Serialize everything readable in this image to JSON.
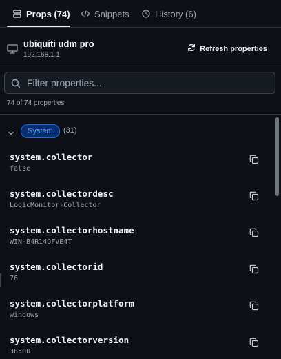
{
  "tabs": [
    {
      "label": "Props (74)",
      "icon": "server-stack-icon",
      "active": true
    },
    {
      "label": "Snippets",
      "icon": "code-icon",
      "active": false
    },
    {
      "label": "History (6)",
      "icon": "clock-icon",
      "active": false
    }
  ],
  "device": {
    "name": "ubiquiti udm pro",
    "ip": "192.168.1.1",
    "icon": "monitor-icon"
  },
  "refresh": {
    "label": "Refresh properties",
    "icon": "refresh-icon"
  },
  "filter": {
    "placeholder": "Filter properties...",
    "value": "",
    "icon": "search-icon"
  },
  "count_text": "74 of 74 properties",
  "group": {
    "badge": "System",
    "count": "(31)",
    "expanded": true
  },
  "properties": [
    {
      "key": "system.collector",
      "value": "false"
    },
    {
      "key": "system.collectordesc",
      "value": "LogicMonitor-Collector"
    },
    {
      "key": "system.collectorhostname",
      "value": "WIN-B4R14QFVE4T"
    },
    {
      "key": "system.collectorid",
      "value": "76"
    },
    {
      "key": "system.collectorplatform",
      "value": "windows"
    },
    {
      "key": "system.collectorversion",
      "value": "38500"
    }
  ],
  "colors": {
    "background": "#0d1117",
    "accent": "#58a6ff",
    "badge_bg": "#0c2d6b",
    "muted": "#9da7b3",
    "border": "#30363d"
  }
}
